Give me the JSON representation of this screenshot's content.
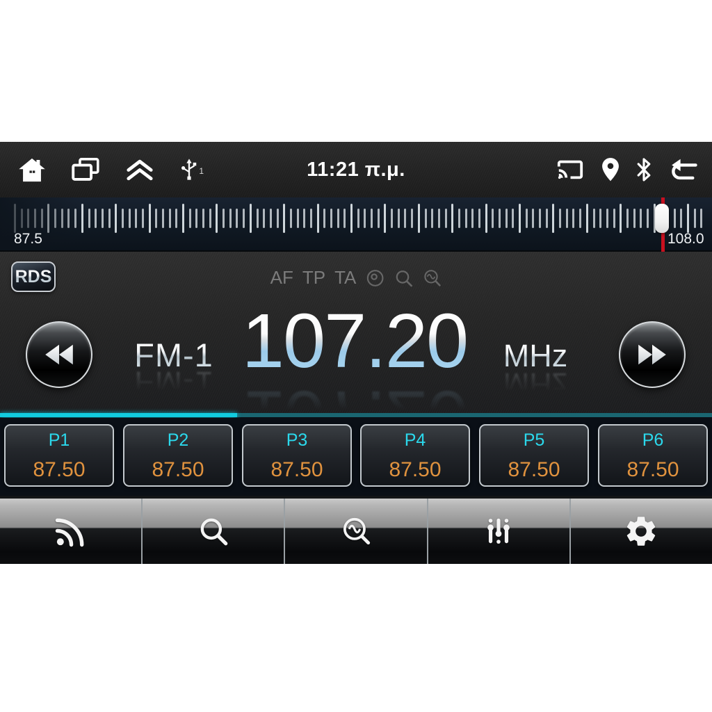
{
  "status_bar": {
    "time": "11:21 π.μ.",
    "usb_count": "1",
    "icons_left": [
      "home",
      "recent-apps",
      "collapse-up",
      "usb"
    ],
    "icons_right": [
      "cast",
      "location",
      "bluetooth",
      "back"
    ]
  },
  "frequency_scale": {
    "min_label": "87.5",
    "max_label": "108.0"
  },
  "radio": {
    "rds_badge": "RDS",
    "indicators": [
      "AF",
      "TP",
      "TA"
    ],
    "indicator_icons": [
      "loop-circle",
      "search",
      "scan-wave"
    ],
    "band": "FM-1",
    "frequency": "107.20",
    "unit": "MHz"
  },
  "presets": [
    {
      "label": "P1",
      "value": "87.50"
    },
    {
      "label": "P2",
      "value": "87.50"
    },
    {
      "label": "P3",
      "value": "87.50"
    },
    {
      "label": "P4",
      "value": "87.50"
    },
    {
      "label": "P5",
      "value": "87.50"
    },
    {
      "label": "P6",
      "value": "87.50"
    }
  ],
  "toolbar": {
    "buttons": [
      "broadcast",
      "seek",
      "scan",
      "equalizer",
      "settings"
    ]
  },
  "colors": {
    "accent_teal": "#12ccdf",
    "teal_dim": "#1a6671",
    "preset_label_cyan": "#2bd9ec",
    "preset_value_orange": "#e0923e",
    "needle_red": "#c8101f",
    "frequency_blue": "#abd7f1"
  }
}
